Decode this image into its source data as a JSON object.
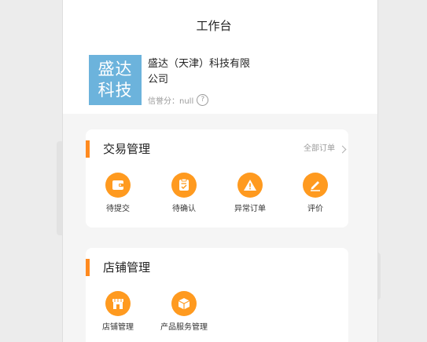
{
  "header": {
    "title": "工作台"
  },
  "company": {
    "logo_text": "盛达科技",
    "logo_line1": "盛达",
    "logo_line2": "科技",
    "name_line1": "盛达（天津）科技有限",
    "name_line2": "公司",
    "credit_label": "信誉分：null",
    "help_glyph": "?"
  },
  "trade": {
    "title": "交易管理",
    "all_orders": "全部订单",
    "items": [
      {
        "label": "待提交",
        "icon": "wallet-icon"
      },
      {
        "label": "待确认",
        "icon": "clipboard-check-icon"
      },
      {
        "label": "异常订单",
        "icon": "warning-icon"
      },
      {
        "label": "评价",
        "icon": "pencil-icon"
      }
    ]
  },
  "shop": {
    "title": "店铺管理",
    "items": [
      {
        "label": "店铺管理",
        "icon": "storefront-icon"
      },
      {
        "label": "产品服务管理",
        "icon": "box-icon"
      }
    ]
  },
  "colors": {
    "accent": "#ff8a1f",
    "icon_bg": "#ff9a1f",
    "logo_bg": "#6cb3dc"
  }
}
